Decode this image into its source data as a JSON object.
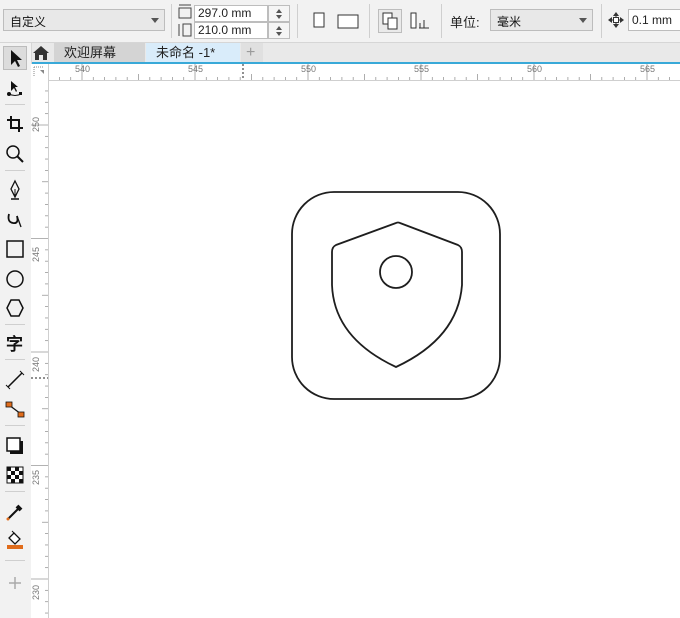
{
  "propbar": {
    "page_size_preset": "自定义",
    "width_value": "297.0 mm",
    "height_value": "210.0 mm",
    "units_label": "单位:",
    "units_value": "毫米",
    "nudge_value": "0.1 mm"
  },
  "tabs": [
    {
      "label": "欢迎屏幕",
      "active": false
    },
    {
      "label": "未命名 -1*",
      "active": true
    }
  ],
  "new_tab_label": "+",
  "ruler": {
    "horizontal": [
      "540",
      "545",
      "550",
      "555",
      "560",
      "565"
    ],
    "vertical": [
      "250",
      "245",
      "240",
      "235",
      "230"
    ]
  },
  "tools": [
    "pick-tool-icon",
    "shape-tool-icon",
    "crop-tool-icon",
    "zoom-tool-icon",
    "freehand-tool-icon",
    "artistic-media-icon",
    "rectangle-tool-icon",
    "ellipse-tool-icon",
    "polygon-tool-icon",
    "text-tool-icon",
    "dimension-tool-icon",
    "connector-tool-icon",
    "drop-shadow-icon",
    "transparency-icon",
    "eyedropper-icon",
    "interactive-fill-icon",
    "add-tool-icon"
  ],
  "colors": {
    "accent": "#39a9d8",
    "active_tab_bg": "#d9ecfa",
    "inactive_tab_bg": "#d4d4d4",
    "drawing_stroke": "#1e1e1e"
  }
}
